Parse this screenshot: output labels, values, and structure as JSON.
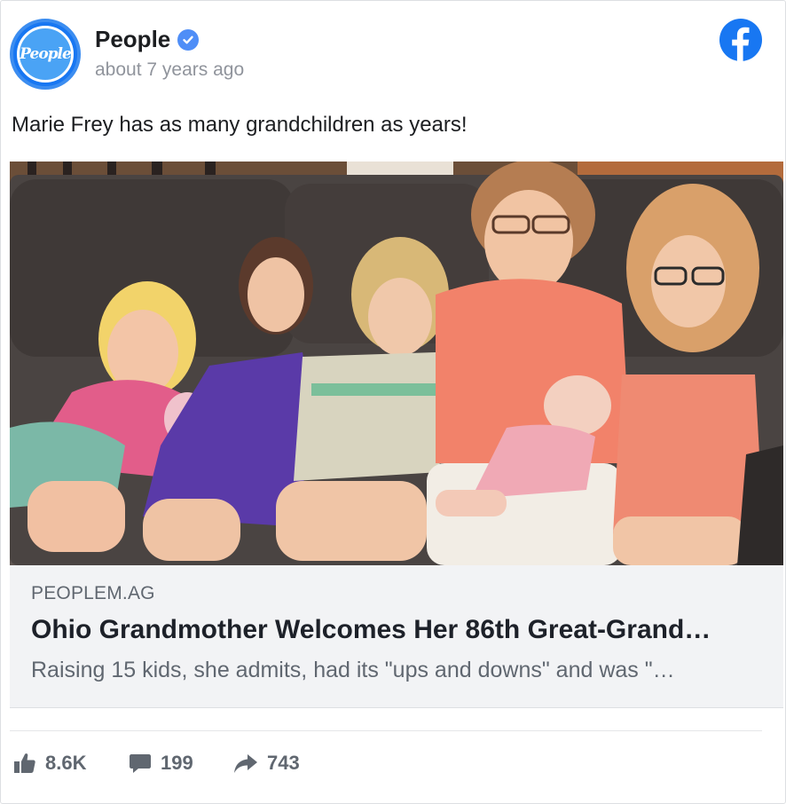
{
  "post": {
    "page_name": "People",
    "avatar_text": "People",
    "timestamp": "about 7 years ago",
    "text": "Marie Frey has as many grandchildren as years!"
  },
  "link": {
    "domain": "PEOPLEM.AG",
    "title": "Ohio Grandmother Welcomes Her 86th Great-Grand…",
    "description": "Raising 15 kids, she admits, had its \"ups and downs\" and was \"…"
  },
  "stats": {
    "likes": "8.6K",
    "comments": "199",
    "shares": "743"
  },
  "icons": {
    "verified": "verified-badge-icon",
    "facebook": "facebook-logo-icon",
    "like": "thumbs-up-icon",
    "comment": "comment-bubble-icon",
    "share": "share-arrow-icon"
  },
  "colors": {
    "facebook_blue": "#1877f2",
    "verified_blue": "#4f8ef7",
    "muted_text": "#606770",
    "link_box_bg": "#f2f3f5"
  }
}
